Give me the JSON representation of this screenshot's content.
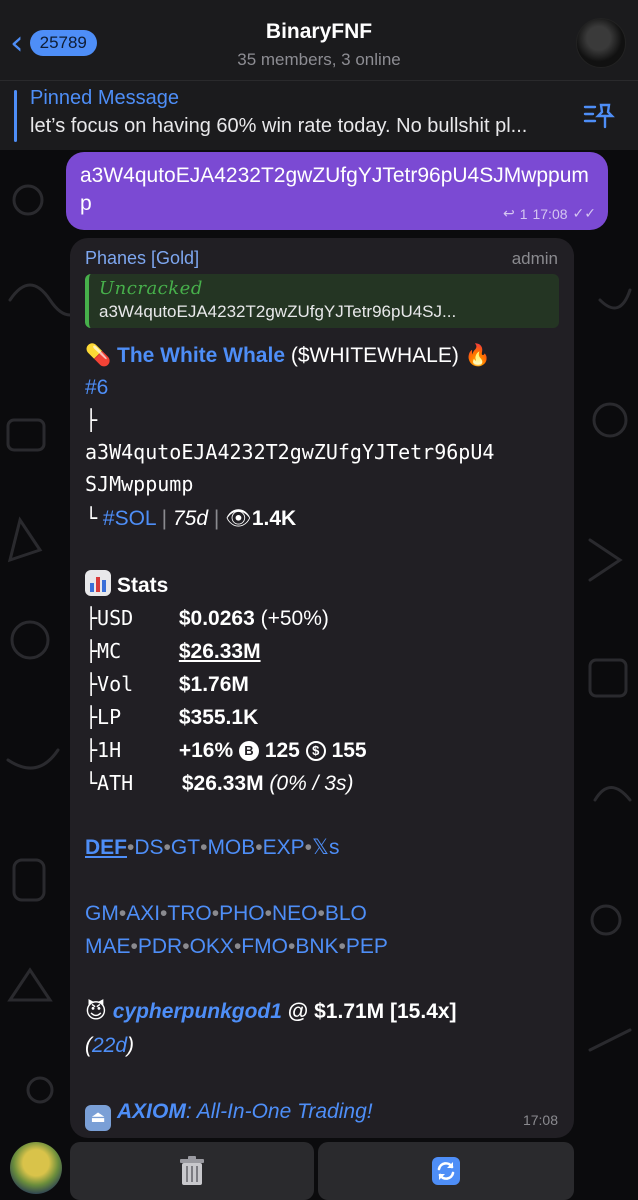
{
  "header": {
    "back_count": "25789",
    "title": "BinaryFNF",
    "subtitle": "35 members, 3 online"
  },
  "pinned": {
    "title": "Pinned Message",
    "text": "let’s focus on having 60% win rate today. No bullshit pl..."
  },
  "outgoing": {
    "text": "a3W4qutoEJA4232T2gwZUfgYJTetr96pU4SJMwppump",
    "replies": "1",
    "time": "17:08"
  },
  "incoming": {
    "sender": "Phanes [Gold]",
    "role": "admin",
    "reply_title": "Uncracked",
    "reply_text": "a3W4qutoEJA4232T2gwZUfgYJTetr96pU4SJ...",
    "token_name": "The White Whale",
    "token_ticker": "($WHITEWHALE)",
    "rank": "#6",
    "tree_top": "├",
    "address_line1": "a3W4qutoEJA4232T2gwZUfgYJTetr96pU4",
    "address_line2": "SJMwppump",
    "tree_end": "└",
    "chain": "#SOL",
    "age": "75d",
    "views": "1.4K",
    "stats_title": "Stats",
    "stats": {
      "usd_label": "├USD",
      "usd_value": "$0.0263",
      "usd_change": "(+50%)",
      "mc_label": "├MC",
      "mc_value": "$26.33M",
      "vol_label": "├Vol",
      "vol_value": "$1.76M",
      "lp_label": "├LP",
      "lp_value": "$355.1K",
      "h1_label": "├1H",
      "h1_value": "+16%",
      "h1_buys": "125",
      "h1_sells": "155",
      "ath_label": "└ATH",
      "ath_value": "$26.33M",
      "ath_detail": "(0% / 3s)"
    },
    "links1": [
      "DEF",
      "DS",
      "GT",
      "MOB",
      "EXP",
      "𝕏s"
    ],
    "links2": [
      "GM",
      "AXI",
      "TRO",
      "PHO",
      "NEO",
      "BLO"
    ],
    "links3": [
      "MAE",
      "PDR",
      "OKX",
      "FMO",
      "BNK",
      "PEP"
    ],
    "caller": "cypherpunkgod1",
    "caller_at": "@",
    "caller_mc": "$1.71M [15.4x]",
    "caller_age": "22d",
    "ad_name": "AXIOM",
    "ad_text": "All-In-One Trading!",
    "time": "17:08"
  },
  "icons": {
    "back": "chevron-left-icon",
    "pin": "pin-list-icon",
    "pill": "pill-emoji-icon",
    "fire": "fire-emoji-icon",
    "eye": "eye-emoji-icon",
    "chart": "bar-chart-emoji-icon",
    "devil": "smiling-imp-emoji-icon",
    "eject": "eject-emoji-icon",
    "trash": "trash-icon",
    "refresh": "refresh-icon"
  },
  "colors": {
    "accent": "#4e8ef7",
    "outgoing_bubble": "#7b4ad3",
    "incoming_bubble": "#211f24",
    "reply_green": "#47b04b"
  }
}
